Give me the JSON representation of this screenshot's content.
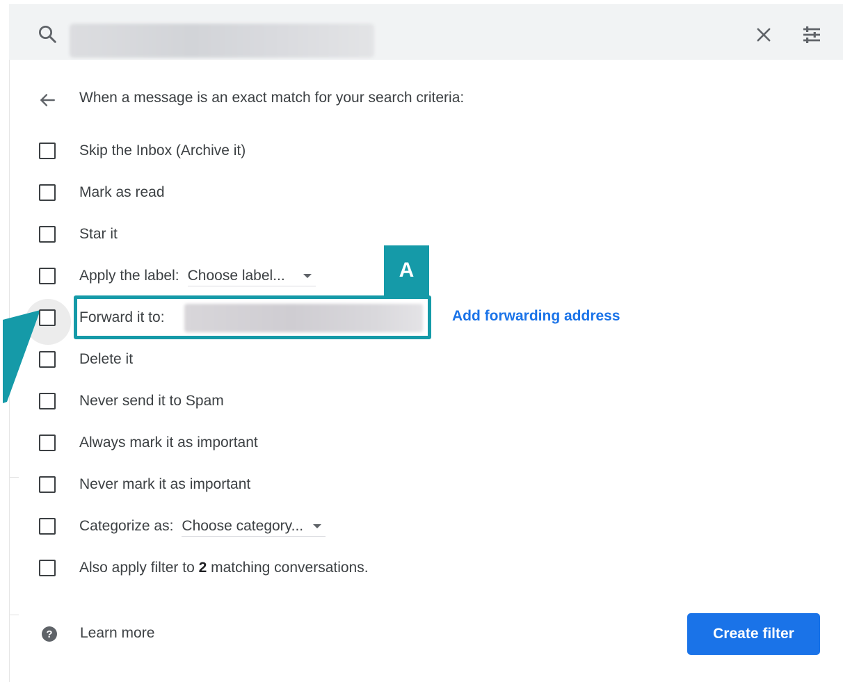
{
  "search": {
    "search_icon": "search-icon",
    "clear_icon": "close-icon",
    "options_icon": "tune-icon"
  },
  "filter": {
    "header": "When a message is an exact match for your search criteria:",
    "options": [
      {
        "label": "Skip the Inbox (Archive it)",
        "checked": false
      },
      {
        "label": "Mark as read",
        "checked": false
      },
      {
        "label": "Star it",
        "checked": false
      },
      {
        "label": "Apply the label:",
        "select": "Choose label...",
        "checked": false
      },
      {
        "label": "Forward it to:",
        "checked": false
      },
      {
        "label": "Delete it",
        "checked": false
      },
      {
        "label": "Never send it to Spam",
        "checked": false
      },
      {
        "label": "Always mark it as important",
        "checked": false
      },
      {
        "label": "Never mark it as important",
        "checked": false
      },
      {
        "label": "Categorize as:",
        "select": "Choose category...",
        "checked": false
      },
      {
        "label_prefix": "Also apply filter to",
        "count": "2",
        "label_suffix": "matching conversations.",
        "checked": false
      }
    ],
    "add_forwarding": "Add forwarding address",
    "learn_more": "Learn more",
    "create_filter": "Create filter"
  },
  "annotation": {
    "badge": "A",
    "color": "#159aa8"
  },
  "colors": {
    "accent": "#1a73e8",
    "highlight": "#159aa8"
  }
}
